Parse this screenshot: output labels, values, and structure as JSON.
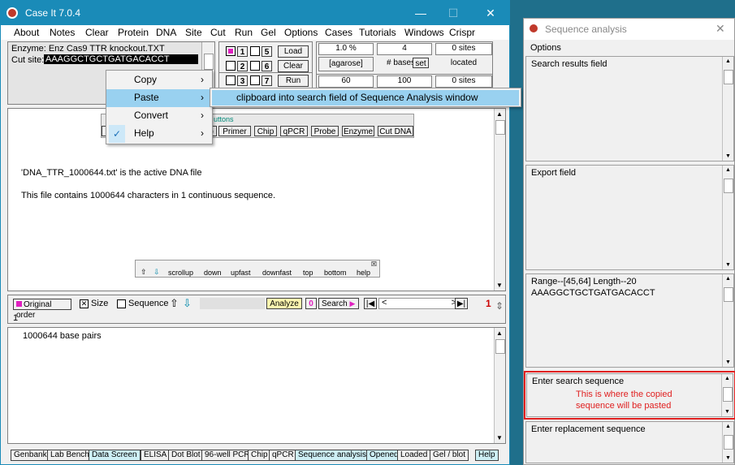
{
  "main": {
    "title": "Case It 7.0.4",
    "menu": [
      "About",
      "Notes",
      "Clear",
      "Protein",
      "DNA",
      "Site",
      "Cut",
      "Run",
      "Gel",
      "Options",
      "Cases",
      "Tutorials",
      "Windows",
      "Crispr"
    ],
    "enzyme_label": "Enzyme: Enz Cas9 TTR knockout.TXT",
    "cutsite_label": "Cut site:",
    "cutsite_value": "AAAGGCTGCTGATGACACCT",
    "lanes": [
      "1",
      "2",
      "3",
      "5",
      "6",
      "7"
    ],
    "load": "Load",
    "clear": "Clear",
    "run": "Run",
    "agarose_pct": "1.0 %",
    "agarose_label": "[agarose]",
    "gel_val": "60",
    "bases_val": "4",
    "bases_label": "# bases",
    "set": "set",
    "bases2": "100",
    "sites1": "0  sites",
    "located": "located",
    "sites2": "0  sites",
    "toolbar_title": "uttons",
    "toolbar_buttons": [
      "p",
      "Primer",
      "Chip",
      "qPCR",
      "Probe",
      "Enzyme",
      "Cut DNA"
    ],
    "active_file": "'DNA_TTR_1000644.txt' is the active DNA file",
    "file_info": "This file contains 1000644 characters in 1 continuous sequence.",
    "scroll_buttons": [
      "scrollup",
      "down",
      "upfast",
      "downfast",
      "top",
      "bottom",
      "help"
    ],
    "original_order": "Original order",
    "size": "Size",
    "sequence": "Sequence",
    "analyze": "Analyze",
    "search_num": "0",
    "search": "Search",
    "page_num": "1",
    "position": "1",
    "base_pairs": "1000644 base pairs",
    "bottom_tabs": [
      "Genbank",
      "Lab Bench",
      "Data Screen",
      "ELISA",
      "Dot Blot",
      "96-well PCR",
      "Chip",
      "qPCR",
      "Sequence analysis",
      "Opened",
      "Loaded",
      "Gel / blot",
      "Help"
    ]
  },
  "context_menu": {
    "items": [
      "Copy",
      "Paste",
      "Convert",
      "Help"
    ],
    "submenu": "clipboard into search field of Sequence Analysis window"
  },
  "side": {
    "title": "Sequence analysis",
    "menu": "Options",
    "search_results": "Search results field",
    "export": "Export field",
    "range": "Range--[45,64]  Length--20",
    "range_seq": "AAAGGCTGCTGATGACACCT",
    "enter_search": "Enter search sequence",
    "annotation_1": "This is where the copied",
    "annotation_2": "sequence will be pasted",
    "enter_replacement": "Enter replacement sequence"
  },
  "colors": {
    "title_blue": "#1a8bb8",
    "highlight": "#99d1f0",
    "annotation": "#e02020",
    "lane_active": "#e020c0"
  }
}
